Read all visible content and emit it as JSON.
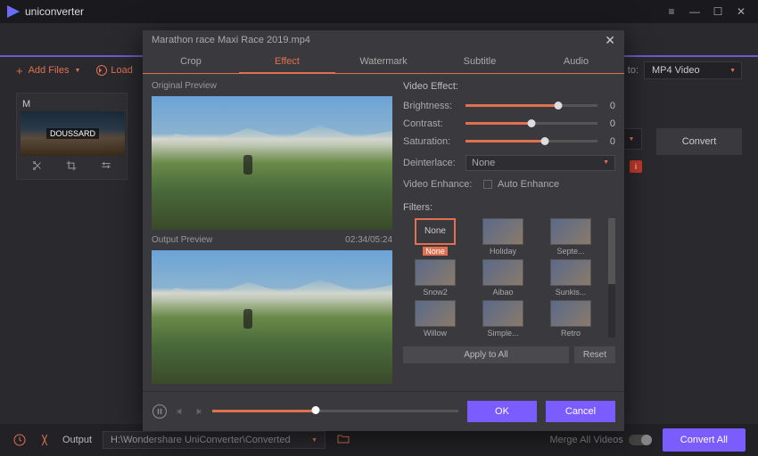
{
  "app": {
    "name": "uniconverter"
  },
  "toolbar": {
    "add_files": "Add Files",
    "load": "Load",
    "output_to_label": "to:",
    "output_format": "MP4 Video"
  },
  "filecard": {
    "prefix": "M",
    "thumb_label": "DOUSSARD",
    "convert": "Convert"
  },
  "footer": {
    "output_label": "Output",
    "output_path": "H:\\Wondershare UniConverter\\Converted",
    "merge_label": "Merge All Videos",
    "convert_all": "Convert All"
  },
  "modal": {
    "filename": "Marathon race  Maxi Race 2019.mp4",
    "tabs": [
      "Crop",
      "Effect",
      "Watermark",
      "Subtitle",
      "Audio"
    ],
    "active_tab": 1,
    "original_label": "Original Preview",
    "output_label": "Output Preview",
    "timecode": "02:34/05:24",
    "effect_title": "Video Effect:",
    "sliders": [
      {
        "label": "Brightness:",
        "pct": 70,
        "value": "0"
      },
      {
        "label": "Contrast:",
        "pct": 50,
        "value": "0"
      },
      {
        "label": "Saturation:",
        "pct": 60,
        "value": "0"
      }
    ],
    "deinterlace_label": "Deinterlace:",
    "deinterlace_value": "None",
    "enhance_label": "Video Enhance:",
    "enhance_chk": "Auto Enhance",
    "filters_label": "Filters:",
    "filters": [
      "None",
      "Holiday",
      "Septe...",
      "Snow2",
      "Aibao",
      "Sunkis...",
      "Willow",
      "Simple...",
      "Retro"
    ],
    "filter_selected": 0,
    "filter_none_text": "None",
    "apply_all": "Apply to All",
    "reset": "Reset",
    "ok": "OK",
    "cancel": "Cancel"
  }
}
